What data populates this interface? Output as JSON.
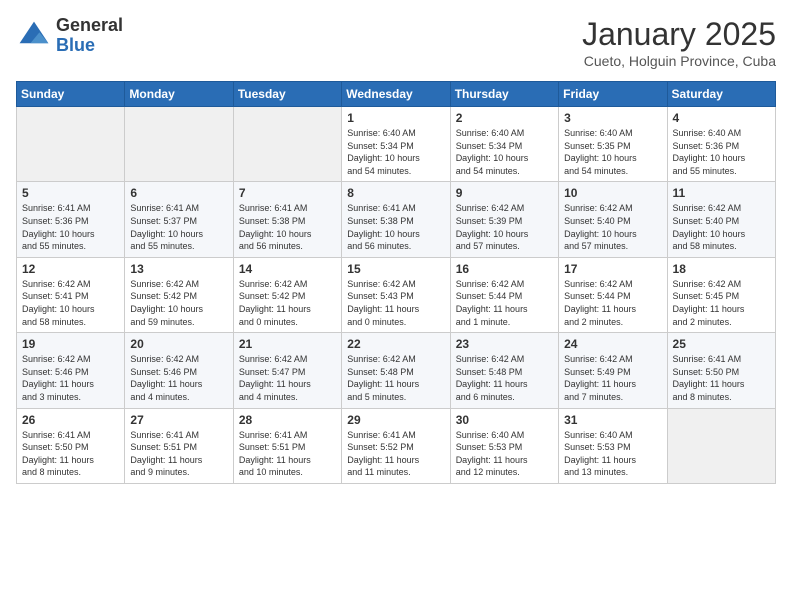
{
  "logo": {
    "general": "General",
    "blue": "Blue"
  },
  "header": {
    "month": "January 2025",
    "location": "Cueto, Holguin Province, Cuba"
  },
  "days_of_week": [
    "Sunday",
    "Monday",
    "Tuesday",
    "Wednesday",
    "Thursday",
    "Friday",
    "Saturday"
  ],
  "weeks": [
    [
      {
        "day": "",
        "info": ""
      },
      {
        "day": "",
        "info": ""
      },
      {
        "day": "",
        "info": ""
      },
      {
        "day": "1",
        "info": "Sunrise: 6:40 AM\nSunset: 5:34 PM\nDaylight: 10 hours\nand 54 minutes."
      },
      {
        "day": "2",
        "info": "Sunrise: 6:40 AM\nSunset: 5:34 PM\nDaylight: 10 hours\nand 54 minutes."
      },
      {
        "day": "3",
        "info": "Sunrise: 6:40 AM\nSunset: 5:35 PM\nDaylight: 10 hours\nand 54 minutes."
      },
      {
        "day": "4",
        "info": "Sunrise: 6:40 AM\nSunset: 5:36 PM\nDaylight: 10 hours\nand 55 minutes."
      }
    ],
    [
      {
        "day": "5",
        "info": "Sunrise: 6:41 AM\nSunset: 5:36 PM\nDaylight: 10 hours\nand 55 minutes."
      },
      {
        "day": "6",
        "info": "Sunrise: 6:41 AM\nSunset: 5:37 PM\nDaylight: 10 hours\nand 55 minutes."
      },
      {
        "day": "7",
        "info": "Sunrise: 6:41 AM\nSunset: 5:38 PM\nDaylight: 10 hours\nand 56 minutes."
      },
      {
        "day": "8",
        "info": "Sunrise: 6:41 AM\nSunset: 5:38 PM\nDaylight: 10 hours\nand 56 minutes."
      },
      {
        "day": "9",
        "info": "Sunrise: 6:42 AM\nSunset: 5:39 PM\nDaylight: 10 hours\nand 57 minutes."
      },
      {
        "day": "10",
        "info": "Sunrise: 6:42 AM\nSunset: 5:40 PM\nDaylight: 10 hours\nand 57 minutes."
      },
      {
        "day": "11",
        "info": "Sunrise: 6:42 AM\nSunset: 5:40 PM\nDaylight: 10 hours\nand 58 minutes."
      }
    ],
    [
      {
        "day": "12",
        "info": "Sunrise: 6:42 AM\nSunset: 5:41 PM\nDaylight: 10 hours\nand 58 minutes."
      },
      {
        "day": "13",
        "info": "Sunrise: 6:42 AM\nSunset: 5:42 PM\nDaylight: 10 hours\nand 59 minutes."
      },
      {
        "day": "14",
        "info": "Sunrise: 6:42 AM\nSunset: 5:42 PM\nDaylight: 11 hours\nand 0 minutes."
      },
      {
        "day": "15",
        "info": "Sunrise: 6:42 AM\nSunset: 5:43 PM\nDaylight: 11 hours\nand 0 minutes."
      },
      {
        "day": "16",
        "info": "Sunrise: 6:42 AM\nSunset: 5:44 PM\nDaylight: 11 hours\nand 1 minute."
      },
      {
        "day": "17",
        "info": "Sunrise: 6:42 AM\nSunset: 5:44 PM\nDaylight: 11 hours\nand 2 minutes."
      },
      {
        "day": "18",
        "info": "Sunrise: 6:42 AM\nSunset: 5:45 PM\nDaylight: 11 hours\nand 2 minutes."
      }
    ],
    [
      {
        "day": "19",
        "info": "Sunrise: 6:42 AM\nSunset: 5:46 PM\nDaylight: 11 hours\nand 3 minutes."
      },
      {
        "day": "20",
        "info": "Sunrise: 6:42 AM\nSunset: 5:46 PM\nDaylight: 11 hours\nand 4 minutes."
      },
      {
        "day": "21",
        "info": "Sunrise: 6:42 AM\nSunset: 5:47 PM\nDaylight: 11 hours\nand 4 minutes."
      },
      {
        "day": "22",
        "info": "Sunrise: 6:42 AM\nSunset: 5:48 PM\nDaylight: 11 hours\nand 5 minutes."
      },
      {
        "day": "23",
        "info": "Sunrise: 6:42 AM\nSunset: 5:48 PM\nDaylight: 11 hours\nand 6 minutes."
      },
      {
        "day": "24",
        "info": "Sunrise: 6:42 AM\nSunset: 5:49 PM\nDaylight: 11 hours\nand 7 minutes."
      },
      {
        "day": "25",
        "info": "Sunrise: 6:41 AM\nSunset: 5:50 PM\nDaylight: 11 hours\nand 8 minutes."
      }
    ],
    [
      {
        "day": "26",
        "info": "Sunrise: 6:41 AM\nSunset: 5:50 PM\nDaylight: 11 hours\nand 8 minutes."
      },
      {
        "day": "27",
        "info": "Sunrise: 6:41 AM\nSunset: 5:51 PM\nDaylight: 11 hours\nand 9 minutes."
      },
      {
        "day": "28",
        "info": "Sunrise: 6:41 AM\nSunset: 5:51 PM\nDaylight: 11 hours\nand 10 minutes."
      },
      {
        "day": "29",
        "info": "Sunrise: 6:41 AM\nSunset: 5:52 PM\nDaylight: 11 hours\nand 11 minutes."
      },
      {
        "day": "30",
        "info": "Sunrise: 6:40 AM\nSunset: 5:53 PM\nDaylight: 11 hours\nand 12 minutes."
      },
      {
        "day": "31",
        "info": "Sunrise: 6:40 AM\nSunset: 5:53 PM\nDaylight: 11 hours\nand 13 minutes."
      },
      {
        "day": "",
        "info": ""
      }
    ]
  ]
}
